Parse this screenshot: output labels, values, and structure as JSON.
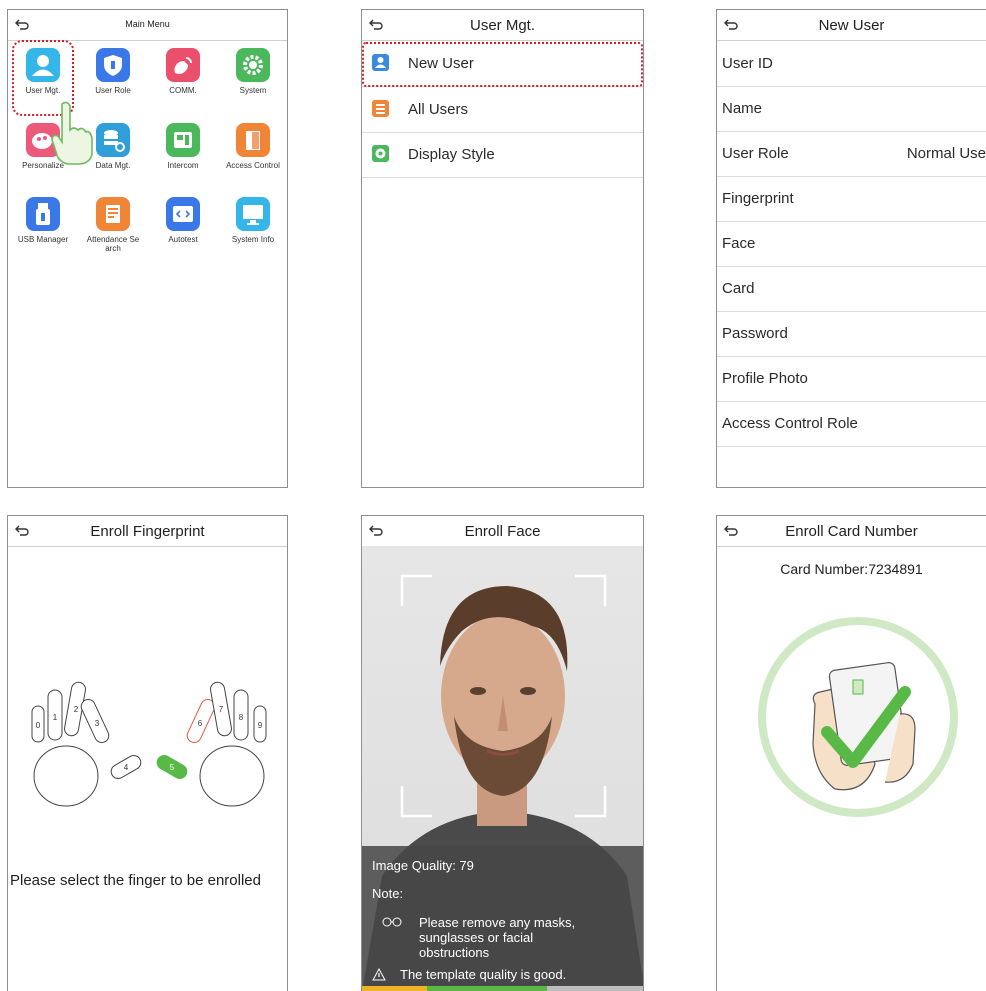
{
  "main_menu": {
    "title": "Main Menu",
    "items": [
      {
        "label": "User Mgt.",
        "color": "#35b6e8",
        "icon": "user-icon"
      },
      {
        "label": "User Role",
        "color": "#3b78e7",
        "icon": "shield-icon"
      },
      {
        "label": "COMM.",
        "color": "#ec4f6b",
        "icon": "satellite-icon"
      },
      {
        "label": "System",
        "color": "#4cb85c",
        "icon": "gear-icon"
      },
      {
        "label": "Personalize",
        "color": "#ec5a7a",
        "icon": "palette-icon"
      },
      {
        "label": "Data Mgt.",
        "color": "#2f9fd9",
        "icon": "database-icon"
      },
      {
        "label": "Intercom",
        "color": "#4cb85c",
        "icon": "intercom-icon"
      },
      {
        "label": "Access Control",
        "color": "#f08437",
        "icon": "door-icon"
      },
      {
        "label": "USB Manager",
        "color": "#3b78e7",
        "icon": "usb-icon"
      },
      {
        "label": "Attendance Search",
        "label_line1": "Attendance Se",
        "label_line2": "arch",
        "color": "#f08437",
        "icon": "report-icon"
      },
      {
        "label": "Autotest",
        "color": "#3b78e7",
        "icon": "code-icon"
      },
      {
        "label": "System Info",
        "color": "#35b6e8",
        "icon": "monitor-icon"
      }
    ]
  },
  "user_mgt": {
    "title": "User Mgt.",
    "items": [
      {
        "label": "New User",
        "color": "#3a8be0"
      },
      {
        "label": "All Users",
        "color": "#f08437"
      },
      {
        "label": "Display Style",
        "color": "#4cb85c"
      }
    ]
  },
  "new_user": {
    "title": "New User",
    "rows": [
      {
        "label": "User ID",
        "value": ""
      },
      {
        "label": "Name",
        "value": ""
      },
      {
        "label": "User Role",
        "value": "Normal Use"
      },
      {
        "label": "Fingerprint",
        "value": ""
      },
      {
        "label": "Face",
        "value": ""
      },
      {
        "label": "Card",
        "value": ""
      },
      {
        "label": "Password",
        "value": ""
      },
      {
        "label": "Profile Photo",
        "value": ""
      },
      {
        "label": "Access Control Role",
        "value": ""
      }
    ]
  },
  "enroll_fingerprint": {
    "title": "Enroll Fingerprint",
    "fingers": [
      "0",
      "1",
      "2",
      "3",
      "4",
      "5",
      "6",
      "7",
      "8",
      "9"
    ],
    "prompt": "Please select the finger to be enrolled"
  },
  "enroll_face": {
    "title": "Enroll Face",
    "quality": "Image Quality: 79",
    "note_label": "Note:",
    "note_text_line1": "Please remove any masks,",
    "note_text_line2": "sunglasses or facial",
    "note_text_line3": "obstructions",
    "status": "The template quality is good."
  },
  "enroll_card": {
    "title": "Enroll Card Number",
    "card_number": "Card Number:7234891",
    "accent": "#59b947"
  }
}
